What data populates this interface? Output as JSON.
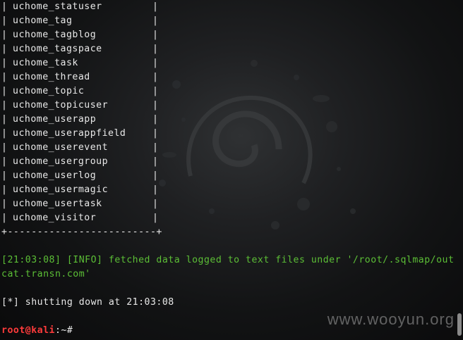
{
  "table": {
    "rows": [
      "uchome_statuser",
      "uchome_tag",
      "uchome_tagblog",
      "uchome_tagspace",
      "uchome_task",
      "uchome_thread",
      "uchome_topic",
      "uchome_topicuser",
      "uchome_userapp",
      "uchome_userappfield",
      "uchome_userevent",
      "uchome_usergroup",
      "uchome_userlog",
      "uchome_usermagic",
      "uchome_usertask",
      "uchome_visitor"
    ],
    "border": "+-------------------------+"
  },
  "log": {
    "info_line": "[21:03:08] [INFO] fetched data logged to text files under '/root/.sqlmap/output/",
    "info_line_cont": "cat.transn.com'",
    "shutdown_line": "[*] shutting down at 21:03:08"
  },
  "prompt": {
    "user": "root@kali",
    "rest": ":~#"
  },
  "watermark": "www.wooyun.org",
  "colors": {
    "info": "#5cbf36",
    "prompt_user": "#ff3b3b",
    "text": "#e9e9e9"
  }
}
